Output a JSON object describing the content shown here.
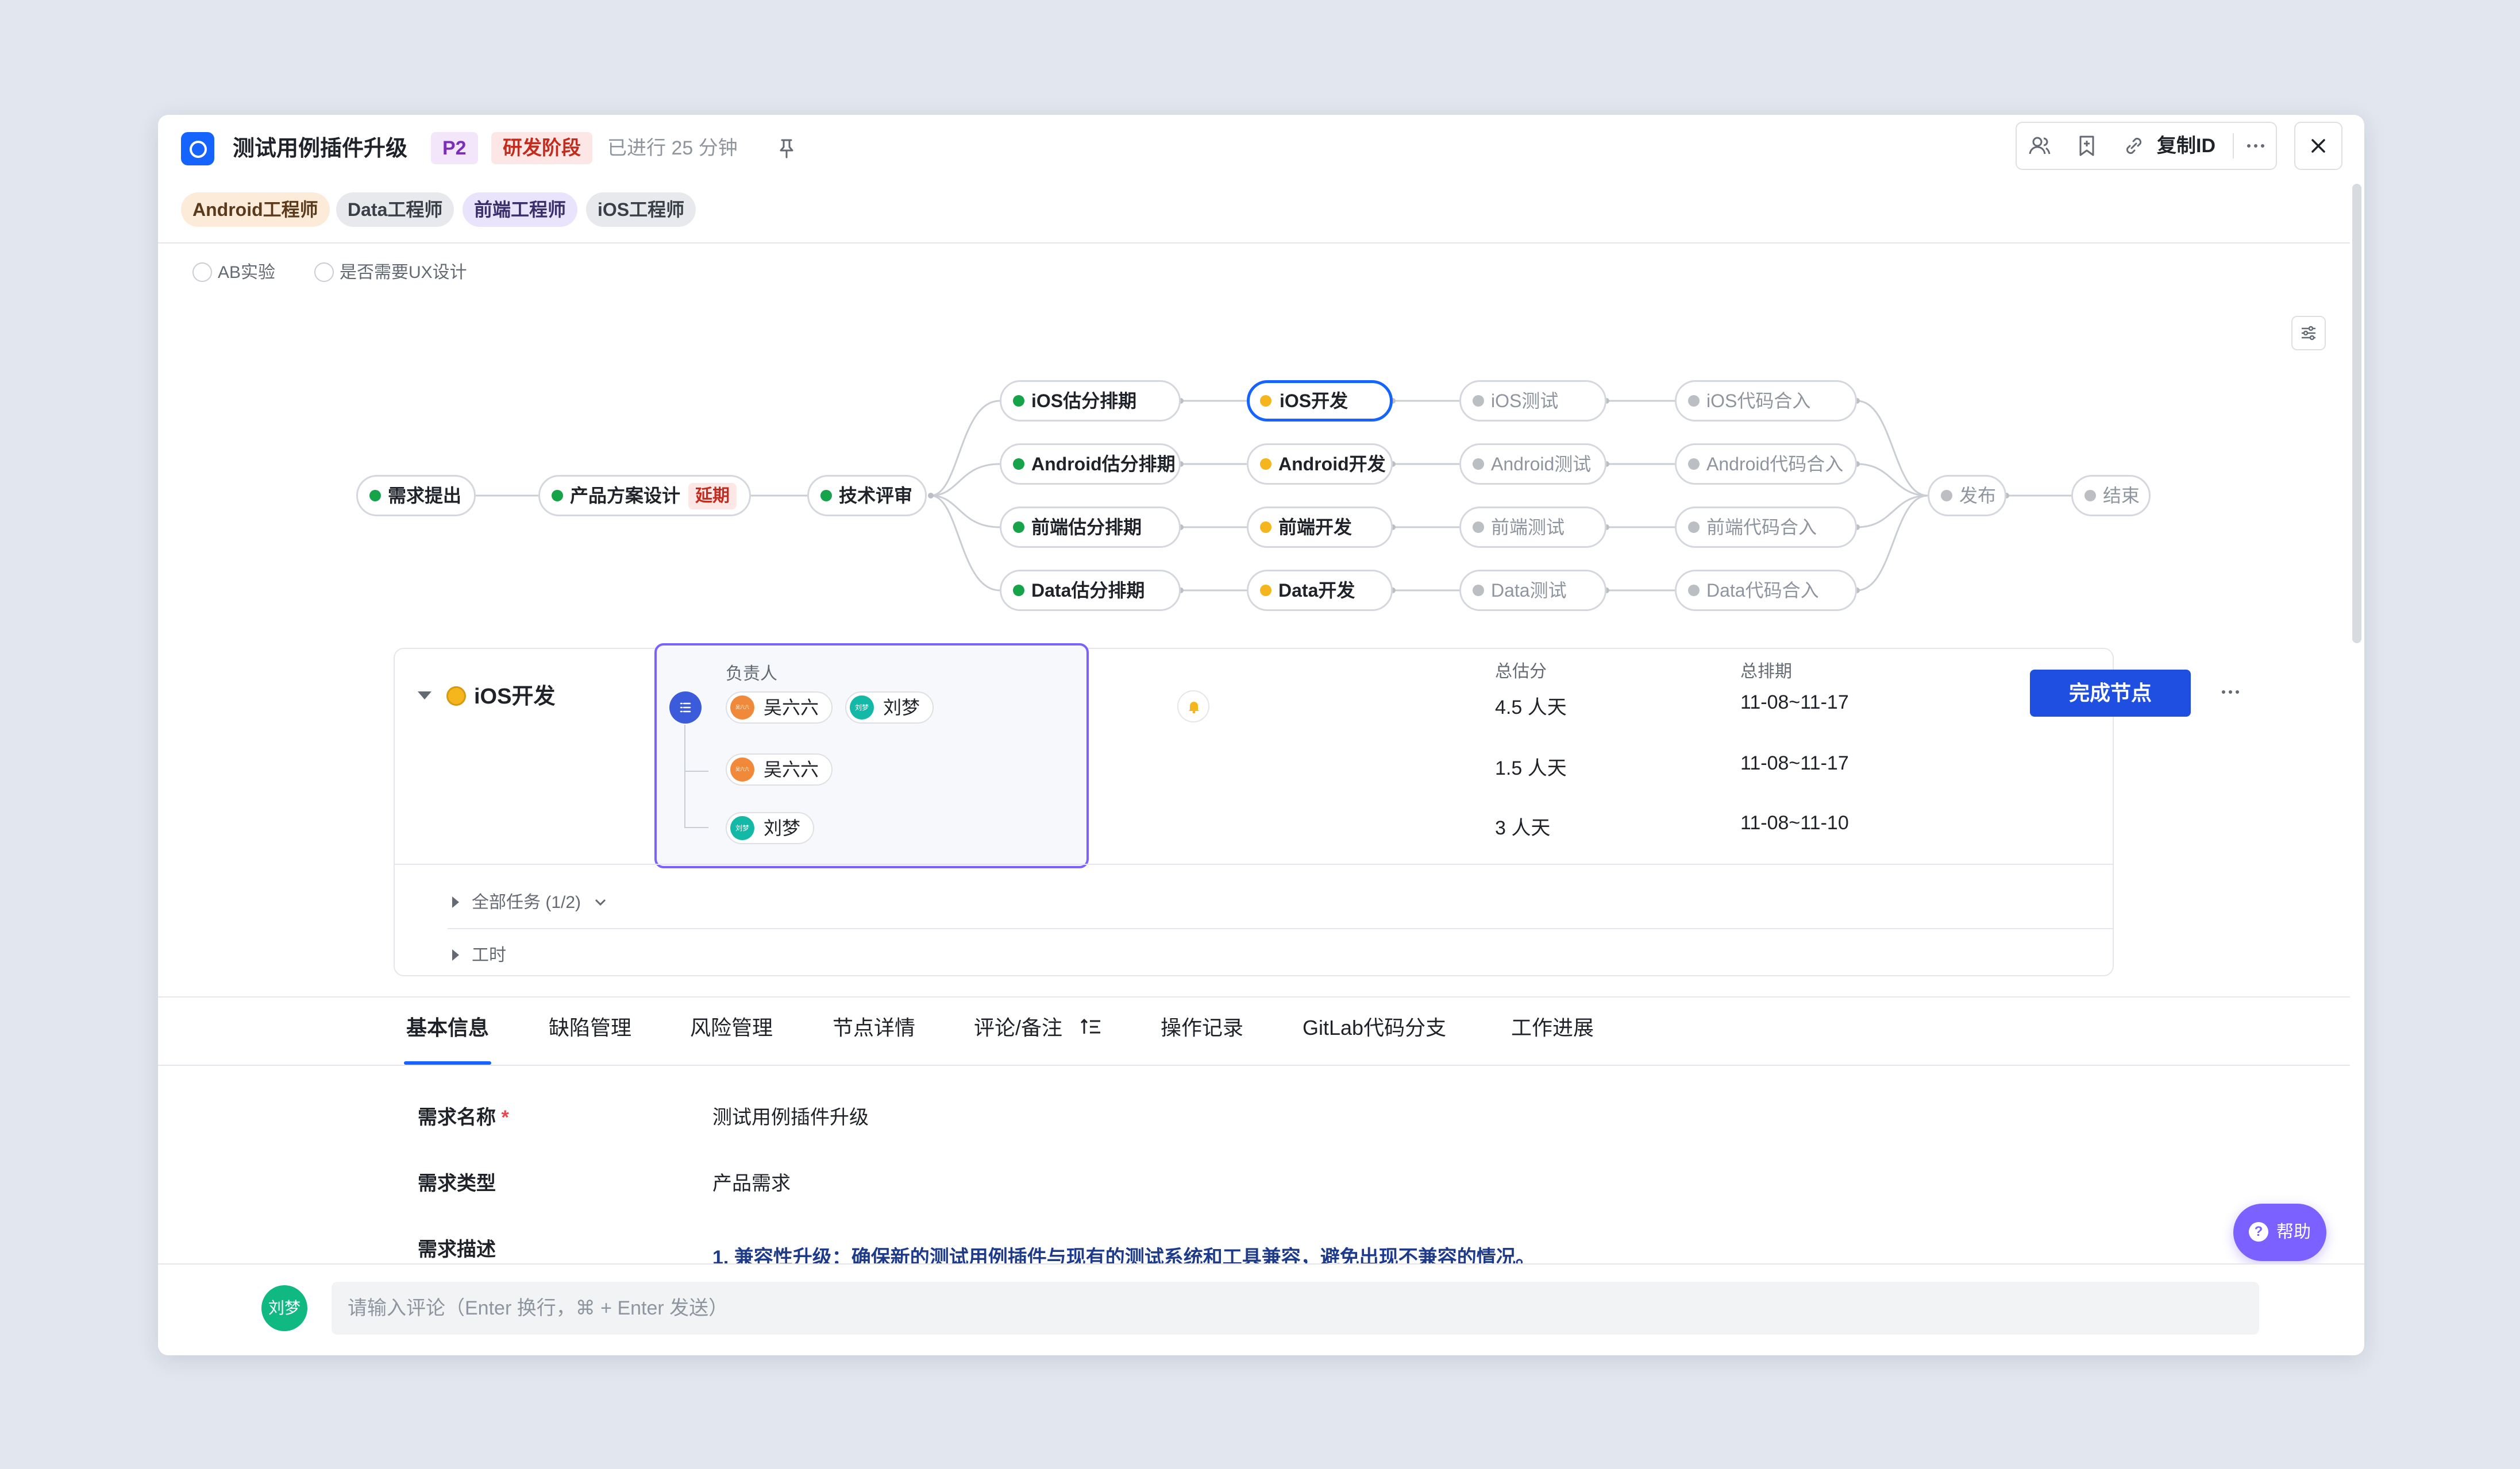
{
  "header": {
    "title": "测试用例插件升级",
    "priority": "P2",
    "stage": "研发阶段",
    "elapsed": "已进行 25 分钟",
    "copy_id_label": "复制ID",
    "icons": [
      "pin-icon",
      "members-icon",
      "bookmark-icon",
      "link-icon",
      "more-icon",
      "close-icon"
    ]
  },
  "role_tags": [
    "Android工程师",
    "Data工程师",
    "前端工程师",
    "iOS工程师"
  ],
  "options": {
    "ab_test": "AB实验",
    "ux_design": "是否需要UX设计"
  },
  "flow": {
    "start": {
      "label": "需求提出",
      "status": "done"
    },
    "design": {
      "label": "产品方案设计",
      "status": "done",
      "badge": "延期"
    },
    "review": {
      "label": "技术评审",
      "status": "done"
    },
    "estimate": [
      {
        "label": "iOS估分排期",
        "status": "done"
      },
      {
        "label": "Android估分排期",
        "status": "done"
      },
      {
        "label": "前端估分排期",
        "status": "done"
      },
      {
        "label": "Data估分排期",
        "status": "done"
      }
    ],
    "develop": [
      {
        "label": "iOS开发",
        "status": "in-progress",
        "active": true
      },
      {
        "label": "Android开发",
        "status": "in-progress"
      },
      {
        "label": "前端开发",
        "status": "in-progress"
      },
      {
        "label": "Data开发",
        "status": "in-progress"
      }
    ],
    "test": [
      {
        "label": "iOS测试",
        "status": "pending"
      },
      {
        "label": "Android测试",
        "status": "pending"
      },
      {
        "label": "前端测试",
        "status": "pending"
      },
      {
        "label": "Data测试",
        "status": "pending"
      }
    ],
    "merge": [
      {
        "label": "iOS代码合入",
        "status": "pending"
      },
      {
        "label": "Android代码合入",
        "status": "pending"
      },
      {
        "label": "前端代码合入",
        "status": "pending"
      },
      {
        "label": "Data代码合入",
        "status": "pending"
      }
    ],
    "release": {
      "label": "发布",
      "status": "pending"
    },
    "end": {
      "label": "结束",
      "status": "pending"
    }
  },
  "node_panel": {
    "name": "iOS开发",
    "col_owner": "负责人",
    "col_estimate": "总估分",
    "col_schedule": "总排期",
    "rows": [
      {
        "owners": [
          {
            "name": "吴六六",
            "avatar": "吴六六"
          },
          {
            "name": "刘梦",
            "avatar": "刘梦"
          }
        ],
        "estimate": "4.5 人天",
        "schedule": "11-08~11-17"
      },
      {
        "owners": [
          {
            "name": "吴六六",
            "avatar": "吴六六"
          }
        ],
        "estimate": "1.5 人天",
        "schedule": "11-08~11-17"
      },
      {
        "owners": [
          {
            "name": "刘梦",
            "avatar": "刘梦"
          }
        ],
        "estimate": "3 人天",
        "schedule": "11-08~11-10"
      }
    ],
    "complete_button": "完成节点",
    "all_tasks": "全部任务 (1/2)",
    "work_hours": "工时"
  },
  "tabs": [
    "基本信息",
    "缺陷管理",
    "风险管理",
    "节点详情",
    "评论/备注",
    "操作记录",
    "GitLab代码分支",
    "工作进展"
  ],
  "selected_tab": "基本信息",
  "form": {
    "name_label": "需求名称",
    "required_mark": "*",
    "name_value": "测试用例插件升级",
    "type_label": "需求类型",
    "type_value": "产品需求",
    "desc_label": "需求描述",
    "desc_first_line": "1.  兼容性升级：确保新的测试用例插件与现有的测试系统和工具兼容，避免出现不兼容的情况。"
  },
  "help_label": "帮助",
  "comment": {
    "avatar": "刘梦",
    "placeholder": "请输入评论（Enter 换行，⌘ + Enter 发送）"
  },
  "colors": {
    "accent": "#1664ff",
    "done": "#16a34a",
    "in_progress": "#f5b51d",
    "pending": "#bbbfc4",
    "highlight": "#7b61ff",
    "delay": "#c42b1c"
  }
}
